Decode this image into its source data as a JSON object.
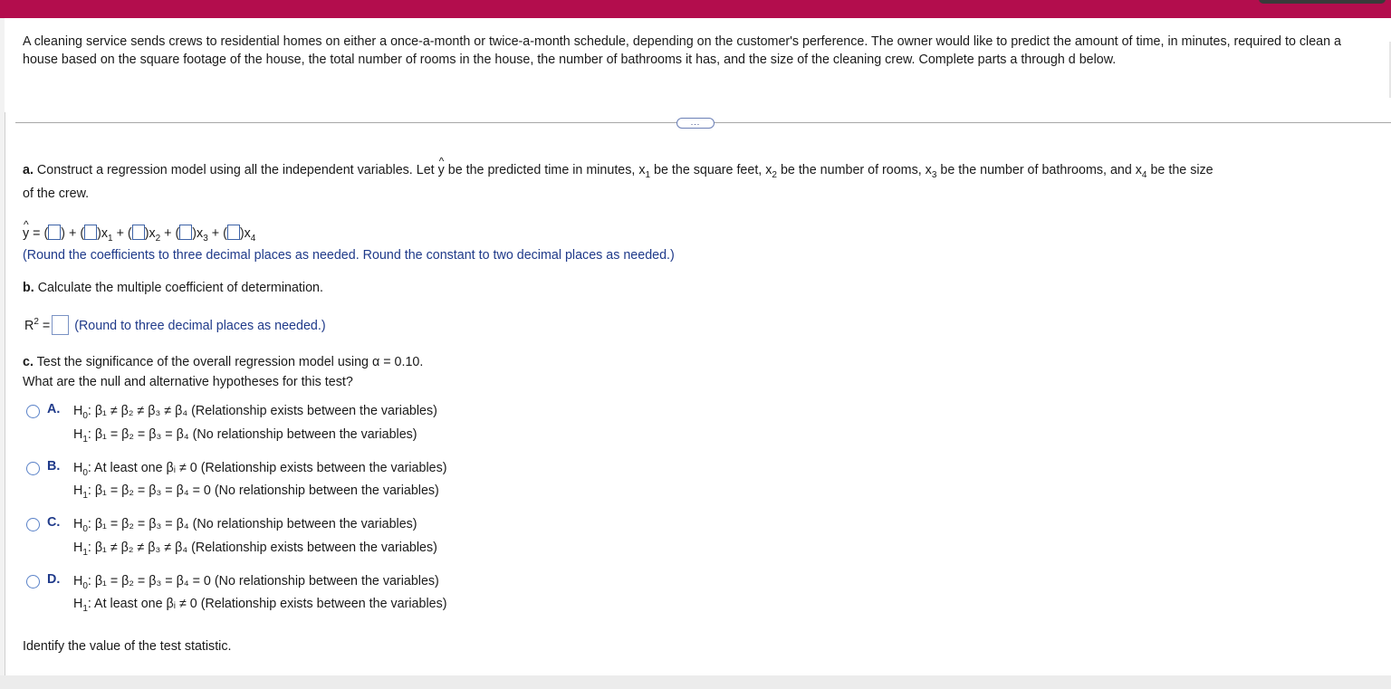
{
  "intro": "A cleaning service sends crews to residential homes on either a once-a-month or twice-a-month schedule, depending on the customer's perference. The owner would like to predict the amount of time, in minutes, required to clean a house based on the square footage of the house, the total number of rooms in the house, the number of bathrooms it has, and the size of the cleaning crew. Complete parts a through d below.",
  "expander_label": "...",
  "part_a": {
    "label": "a.",
    "text1": "Construct a regression model using all the independent variables. Let",
    "yhat": "y",
    "text2": "be the predicted time in minutes, x",
    "s1": "1",
    "text3": "be the square feet, x",
    "s2": "2",
    "text4": "be the number of rooms, x",
    "s3": "3",
    "text5": "be the number of bathrooms, and x",
    "s4": "4",
    "text6": "be the size",
    "line2": "of the crew.",
    "equation_y": "y",
    "eq_equals": "=",
    "plus": "+",
    "x1": "x",
    "x1_sub": "1",
    "x2": "x",
    "x2_sub": "2",
    "x3": "x",
    "x3_sub": "3",
    "x4": "x",
    "x4_sub": "4",
    "hint": "(Round the coefficients to three decimal places as needed. Round the constant to two decimal places as needed.)"
  },
  "part_b": {
    "label": "b.",
    "text": "Calculate the multiple coefficient of determination.",
    "r": "R",
    "r_sup": "2",
    "equals": "=",
    "hint": "(Round to three decimal places as needed.)"
  },
  "part_c": {
    "label": "c.",
    "text": "Test the significance of the overall regression model using α = 0.10.",
    "question": "What are the null and alternative hypotheses for this test?",
    "options": [
      {
        "letter": "A.",
        "h0": "H",
        "h0_sub": "0",
        "h0_text": ": β₁ ≠ β₂ ≠ β₃ ≠ β₄ (Relationship exists between the variables)",
        "h1": "H",
        "h1_sub": "1",
        "h1_text": ": β₁ = β₂ = β₃ = β₄ (No relationship between the variables)"
      },
      {
        "letter": "B.",
        "h0": "H",
        "h0_sub": "0",
        "h0_text": ": At least one βᵢ ≠ 0 (Relationship exists between the variables)",
        "h1": "H",
        "h1_sub": "1",
        "h1_text": ": β₁ = β₂ = β₃ = β₄ = 0 (No relationship between the variables)"
      },
      {
        "letter": "C.",
        "h0": "H",
        "h0_sub": "0",
        "h0_text": ": β₁ = β₂ = β₃ = β₄ (No relationship between the variables)",
        "h1": "H",
        "h1_sub": "1",
        "h1_text": ": β₁ ≠ β₂ ≠ β₃ ≠ β₄ (Relationship exists between the variables)"
      },
      {
        "letter": "D.",
        "h0": "H",
        "h0_sub": "0",
        "h0_text": ": β₁ = β₂ = β₃ = β₄ = 0 (No relationship between the variables)",
        "h1": "H",
        "h1_sub": "1",
        "h1_text": ": At least one βᵢ ≠ 0 (Relationship exists between the variables)"
      }
    ]
  },
  "test_statistic_prompt": "Identify the value of the test statistic.",
  "colors": {
    "topbar": "#b30d4d",
    "link_blue": "#1f3a8a",
    "radio": "#5a82c8"
  }
}
